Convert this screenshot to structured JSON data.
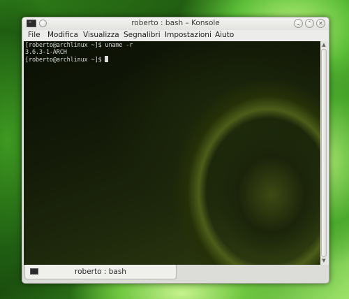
{
  "window": {
    "title": "roberto : bash – Konsole",
    "buttons": [
      "minimize",
      "maximize",
      "close"
    ]
  },
  "menubar": {
    "items": [
      "File",
      "Modifica",
      "Visualizza",
      "Segnalibri",
      "Impostazioni",
      "Aiuto"
    ]
  },
  "terminal": {
    "lines": [
      "[roberto@archlinux ~]$ uname -r",
      "3.6.3-1-ARCH",
      "[roberto@archlinux ~]$ "
    ]
  },
  "tabs": [
    {
      "label": "roberto : bash",
      "icon": "terminal-icon",
      "active": true
    }
  ],
  "colors": {
    "terminal_text": "#d9d9d9",
    "chrome": "#e9e9e6",
    "desktop_green": "#4aa92c"
  }
}
